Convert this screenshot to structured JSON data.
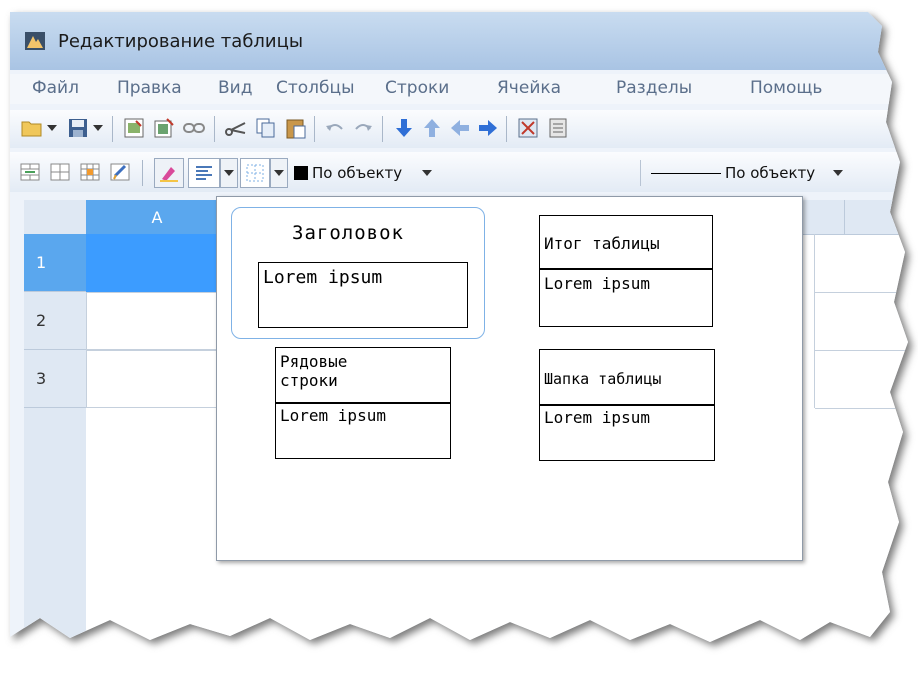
{
  "window": {
    "title": "Редактирование таблицы"
  },
  "menu": [
    "Файл",
    "Правка",
    "Вид",
    "Столбцы",
    "Строки",
    "Ячейка",
    "Разделы",
    "Помощь"
  ],
  "toolbar": {
    "line_color_label": "По объекту",
    "line_style_label": "По объекту"
  },
  "grid": {
    "column_header": "A",
    "rows": [
      "1",
      "2",
      "3"
    ]
  },
  "popup": {
    "options": [
      {
        "name": "title",
        "header": "Заголовок",
        "body": "Lorem ipsum",
        "selected": true
      },
      {
        "name": "total",
        "header": "Итог таблицы",
        "body": "Lorem ipsum",
        "selected": false
      },
      {
        "name": "rows",
        "header": "Рядовые строки",
        "body": "Lorem ipsum",
        "selected": false
      },
      {
        "name": "head",
        "header": "Шапка таблицы",
        "body": "Lorem ipsum",
        "selected": false
      }
    ]
  },
  "colors": {
    "selection": "#3c9cff",
    "accent_border": "#7fb2e6"
  }
}
